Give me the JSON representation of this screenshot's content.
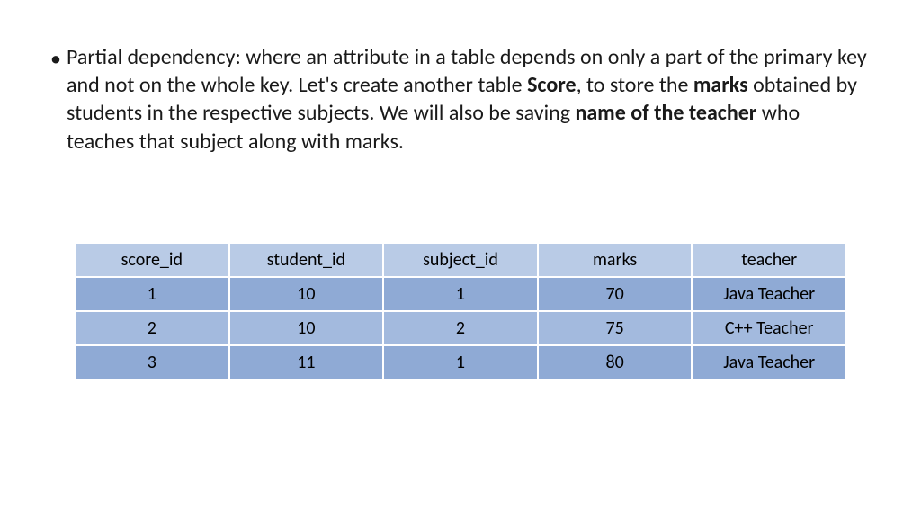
{
  "bullet": {
    "text_1": "Partial dependency: where an attribute in a table depends on only a part of the primary key and not on the whole key. Let's create another table ",
    "bold_1": "Score",
    "text_2": ", to store the ",
    "bold_2": "marks",
    "text_3": " obtained by students in the respective subjects. We will also be saving ",
    "bold_3": "name of the teacher",
    "text_4": " who teaches that subject along with marks."
  },
  "table": {
    "headers": {
      "c0": "score_id",
      "c1": "student_id",
      "c2": "subject_id",
      "c3": "marks",
      "c4": "teacher"
    },
    "rows": [
      {
        "c0": "1",
        "c1": "10",
        "c2": "1",
        "c3": "70",
        "c4": "Java Teacher"
      },
      {
        "c0": "2",
        "c1": "10",
        "c2": "2",
        "c3": "75",
        "c4": "C++ Teacher"
      },
      {
        "c0": "3",
        "c1": "11",
        "c2": "1",
        "c3": "80",
        "c4": "Java Teacher"
      }
    ]
  }
}
